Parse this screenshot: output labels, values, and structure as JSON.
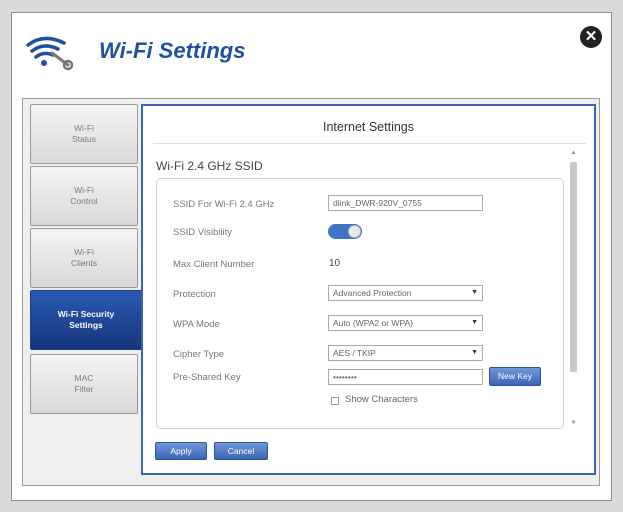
{
  "app": {
    "title": "Wi-Fi Settings",
    "close_icon": "close-icon"
  },
  "sidebar": {
    "items": [
      {
        "label": "Wi-Fi\nStatus",
        "active": false
      },
      {
        "label": "Wi-Fi\nControl",
        "active": false
      },
      {
        "label": "Wi-Fi\nClients",
        "active": false
      },
      {
        "label": "Wi-Fi Security\nSettings",
        "active": true
      },
      {
        "label": "MAC\nFilter",
        "active": false
      }
    ]
  },
  "panel": {
    "title": "Internet Settings",
    "section_title": "Wi-Fi 2.4 GHz SSID",
    "fields": {
      "ssid_label": "SSID For Wi-Fi 2.4 GHz",
      "ssid_value": "dlink_DWR-920V_0755",
      "visibility_label": "SSID Visibility",
      "visibility_on": true,
      "max_client_label": "Max Client Number",
      "max_client_value": "10",
      "protection_label": "Protection",
      "protection_value": "Advanced Protection",
      "wpa_mode_label": "WPA Mode",
      "wpa_mode_value": "Auto (WPA2 or WPA)",
      "cipher_label": "Cipher Type",
      "cipher_value": "AES / TKIP",
      "psk_label": "Pre-Shared Key",
      "psk_value": "••••••••",
      "new_key_label": "New Key",
      "show_chars_label": "Show Characters"
    },
    "apply_label": "Apply",
    "cancel_label": "Cancel"
  },
  "colors": {
    "accent": "#1e4fa0",
    "active_tab": "#1f4a9e",
    "toggle": "#3f73c6"
  }
}
